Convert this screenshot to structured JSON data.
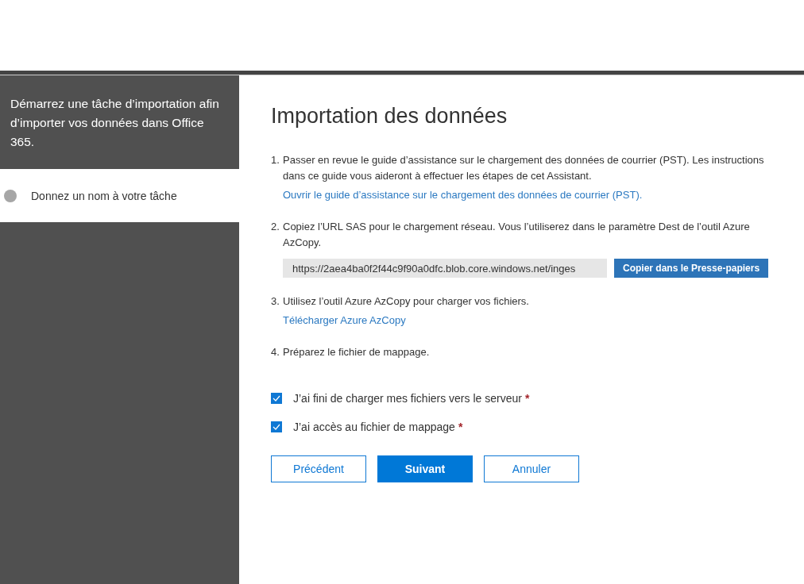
{
  "sidebar": {
    "intro": "Démarrez une tâche d’importation afin d’importer vos données dans Office 365.",
    "steps": [
      {
        "label": "Donnez un nom à votre tâche",
        "selected": true
      }
    ]
  },
  "main": {
    "title": "Importation des données",
    "steps": [
      {
        "number": "1.",
        "text": "Passer en revue le guide d’assistance sur le chargement des données de courrier (PST). Les instructions dans ce guide vous aideront à effectuer les étapes de cet Assistant.",
        "link": "Ouvrir le guide d’assistance sur le chargement des données de courrier (PST)."
      },
      {
        "number": "2.",
        "text": "Copiez l’URL SAS pour le chargement réseau. Vous l’utiliserez dans le paramètre Dest de l’outil Azure AzCopy.",
        "url": "https://2aea4ba0f2f44c9f90a0dfc.blob.core.windows.net/inges",
        "copy_button": "Copier dans le Presse-papiers"
      },
      {
        "number": "3.",
        "text": "Utilisez l’outil Azure AzCopy pour charger vos fichiers.",
        "link": "Télécharger Azure AzCopy"
      },
      {
        "number": "4.",
        "text": "Préparez le fichier de mappage."
      }
    ],
    "checkboxes": [
      {
        "label": "J’ai fini de charger mes fichiers vers le serveur",
        "required": "*",
        "checked": true
      },
      {
        "label": "J’ai accès au fichier de mappage",
        "required": "*",
        "checked": true
      }
    ],
    "buttons": [
      {
        "label": "Précédent",
        "kind": "secondary"
      },
      {
        "label": "Suivant",
        "kind": "primary"
      },
      {
        "label": "Annuler",
        "kind": "secondary"
      }
    ]
  }
}
